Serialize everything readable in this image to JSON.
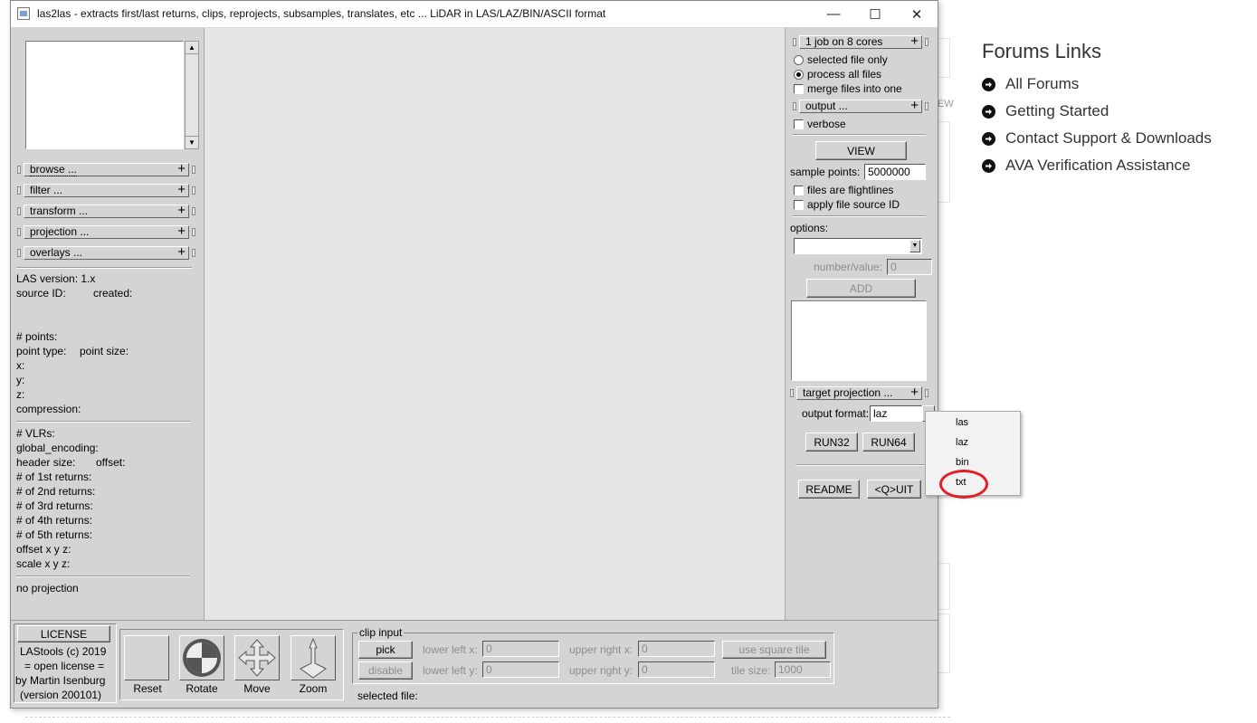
{
  "window": {
    "title": "las2las - extracts first/last returns, clips, reprojects, subsamples, translates, etc ... LiDAR in LAS/LAZ/BIN/ASCII format",
    "minimize": "—",
    "maximize": "☐",
    "close": "✕"
  },
  "left_panel": {
    "rollups": [
      "browse ...",
      "filter ...",
      "transform ...",
      "projection ...",
      "overlays ..."
    ],
    "las_version": "LAS version: 1.x",
    "source_id": "source ID:",
    "created": "created:",
    "points": "# points:",
    "point_type": "point type:",
    "point_size": "point size:",
    "x": "x:",
    "y": "y:",
    "z": "z:",
    "compression": "compression:",
    "vlrs": "# VLRs:",
    "global_encoding": "global_encoding:",
    "header_size": "header size:",
    "offset": "offset:",
    "returns": [
      "# of 1st returns:",
      "# of 2nd returns:",
      "# of 3rd returns:",
      "# of 4th returns:",
      "# of 5th returns:"
    ],
    "offset_xyz": "offset x y z:",
    "scale_xyz": "scale x y z:",
    "projection": "no projection"
  },
  "right_panel": {
    "cores": "1 job on 8 cores",
    "selected_file_only": "selected file only",
    "process_all_files": "process all files",
    "merge_files": "merge files into one",
    "output": "output ...",
    "verbose": "verbose",
    "view": "VIEW",
    "sample_points_label": "sample points:",
    "sample_points_value": "5000000",
    "files_are_flightlines": "files are flightlines",
    "apply_file_source_id": "apply file source ID",
    "options_label": "options:",
    "number_value_label": "number/value:",
    "number_value": "0",
    "add": "ADD",
    "target_projection": "target projection ...",
    "output_format_label": "output format:",
    "output_format_value": "laz",
    "run32": "RUN32",
    "run64": "RUN64",
    "readme": "README",
    "quit": "<Q>UIT"
  },
  "format_popup": {
    "options": [
      "las",
      "laz",
      "bin",
      "txt"
    ],
    "highlighted": "txt"
  },
  "bottom": {
    "license_button": "LICENSE",
    "license_text": [
      "LAStools (c) 2019",
      "= open license =",
      "by Martin Isenburg",
      "(version 200101)"
    ],
    "tools": [
      "Reset",
      "Rotate",
      "Move",
      "Zoom"
    ],
    "clip_input": "clip input",
    "pick": "pick",
    "disable": "disable",
    "lower_left_x": "lower left x:",
    "lower_left_y": "lower left y:",
    "upper_right_x": "upper right x:",
    "upper_right_y": "upper right y:",
    "llx": "0",
    "lly": "0",
    "urx": "0",
    "ury": "0",
    "use_square_tile": "use square tile",
    "tile_size_label": "tile size:",
    "tile_size": "1000",
    "selected_file": "selected file:"
  },
  "forums": {
    "title": "Forums Links",
    "links": [
      "All Forums",
      "Getting Started",
      "Contact Support & Downloads",
      "AVA Verification Assistance"
    ]
  },
  "background": {
    "partial_text": "EW"
  },
  "colors": {
    "window_gray": "#d4d4d4",
    "viewer_gray": "#e6e6e6",
    "highlight_circle": "#e0202a"
  }
}
